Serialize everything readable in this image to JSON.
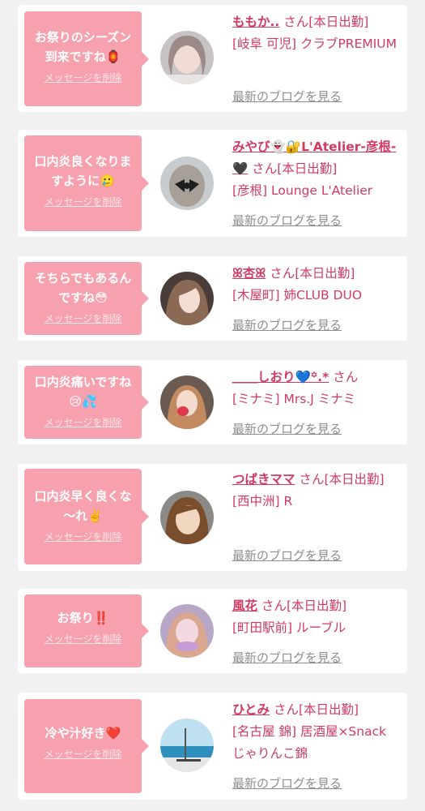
{
  "messages": [
    {
      "message": "お祭りのシーズン\n到来ですね🏮",
      "delete_label": "メッセージを削除",
      "name": "ももか..",
      "suffix": "さん[本日出勤]",
      "shop": "[岐阜 可児] クラブPREMIUM",
      "blog_label": "最新のブログを見る"
    },
    {
      "message": "口内炎良くなりま\nすように🥲",
      "delete_label": "メッセージを削除",
      "name": "みやび👻🔐L'Atelier-彦根-🖤",
      "suffix": "さん[本日出勤]",
      "shop": "[彦根] Lounge L'Atelier",
      "blog_label": "最新のブログを見る"
    },
    {
      "message": "そちらでもあるん\nですね😳",
      "delete_label": "メッセージを削除",
      "name": "ꕤ杏ꕤ",
      "suffix": "さん[本日出勤]",
      "shop": "[木屋町] 姉CLUB DUO",
      "blog_label": "最新のブログを見る"
    },
    {
      "message": "口内炎痛いですね\n😢💦",
      "delete_label": "メッセージを削除",
      "name": "＿＿しおり💙꙳.*",
      "suffix": "さん",
      "shop": "[ミナミ] Mrs.J ミナミ",
      "blog_label": "最新のブログを見る"
    },
    {
      "message": "口内炎早く良くな\n〜れ✌️",
      "delete_label": "メッセージを削除",
      "name": "つばきママ",
      "suffix": "さん[本日出勤]",
      "shop": "[西中洲] R",
      "blog_label": "最新のブログを見る"
    },
    {
      "message": "お祭り‼️",
      "delete_label": "メッセージを削除",
      "name": "風花",
      "suffix": "さん[本日出勤]",
      "shop": "[町田駅前] ルーブル",
      "blog_label": "最新のブログを見る"
    },
    {
      "message": "冷や汁好き❤️",
      "delete_label": "メッセージを削除",
      "name": "ひとみ",
      "suffix": "さん[本日出勤]",
      "shop": "[名古屋 錦] 居酒屋×Snack じゃりんこ錦",
      "blog_label": "最新のブログを見る"
    }
  ],
  "colors": {
    "bubble": "#f7a1ae",
    "name": "#d23a62",
    "blog_link": "#8d8d8d",
    "background": "#f1f1f1"
  }
}
